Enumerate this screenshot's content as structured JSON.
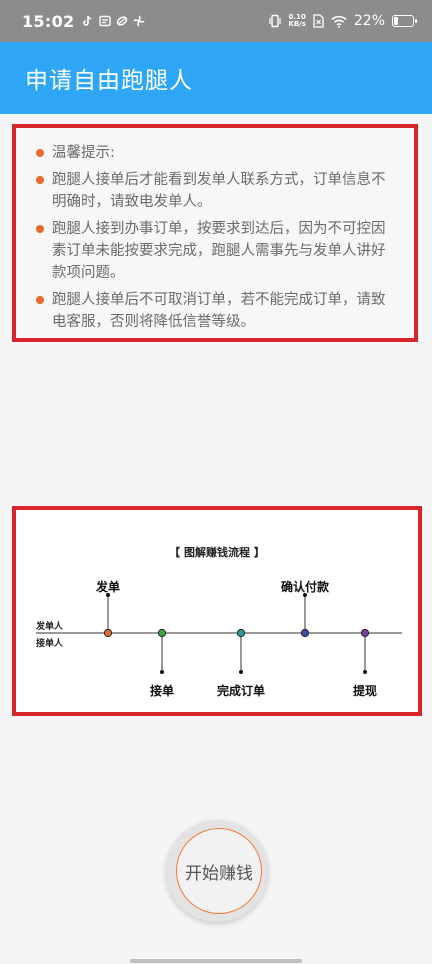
{
  "status_bar": {
    "time": "15:02",
    "net_speed_value": "0.10",
    "net_speed_unit": "KB/s",
    "battery": "22%",
    "battery_level": 0.22,
    "icons": [
      "tiktok-icon",
      "message-icon",
      "link-icon",
      "fan-icon",
      "vibrate-icon",
      "network-speed",
      "sim-icon",
      "wifi-icon",
      "battery-icon"
    ]
  },
  "header": {
    "title": "申请自由跑腿人"
  },
  "tips": {
    "items": [
      "温馨提示:",
      "跑腿人接单后才能看到发单人联系方式，订单信息不明确时，请致电发单人。",
      "跑腿人接到办事订单，按要求到达后，因为不可控因素订单未能按要求完成，跑腿人需事先与发单人讲好款项问题。",
      "跑腿人接单后不可取消订单，若不能完成订单，请致电客服，否则将降低信誉等级。"
    ],
    "bullet_color": "#e86a2c"
  },
  "flow": {
    "title": "【 图解赚钱流程 】",
    "lane_top": "发单人",
    "lane_bottom": "接单人",
    "steps": [
      {
        "label": "发单",
        "side": "top",
        "color": "#e86a2c"
      },
      {
        "label": "接单",
        "side": "bottom",
        "color": "#3aa83a"
      },
      {
        "label": "完成订单",
        "side": "bottom",
        "color": "#2a9d9d"
      },
      {
        "label": "确认付款",
        "side": "top",
        "color": "#3b4db0"
      },
      {
        "label": "提现",
        "side": "bottom",
        "color": "#7b3fa0"
      }
    ]
  },
  "start_button": {
    "label": "开始赚钱"
  },
  "colors": {
    "app_bar": "#2ea6f5",
    "frame_border": "#d9262c",
    "button_ring": "#ee7a3c"
  }
}
